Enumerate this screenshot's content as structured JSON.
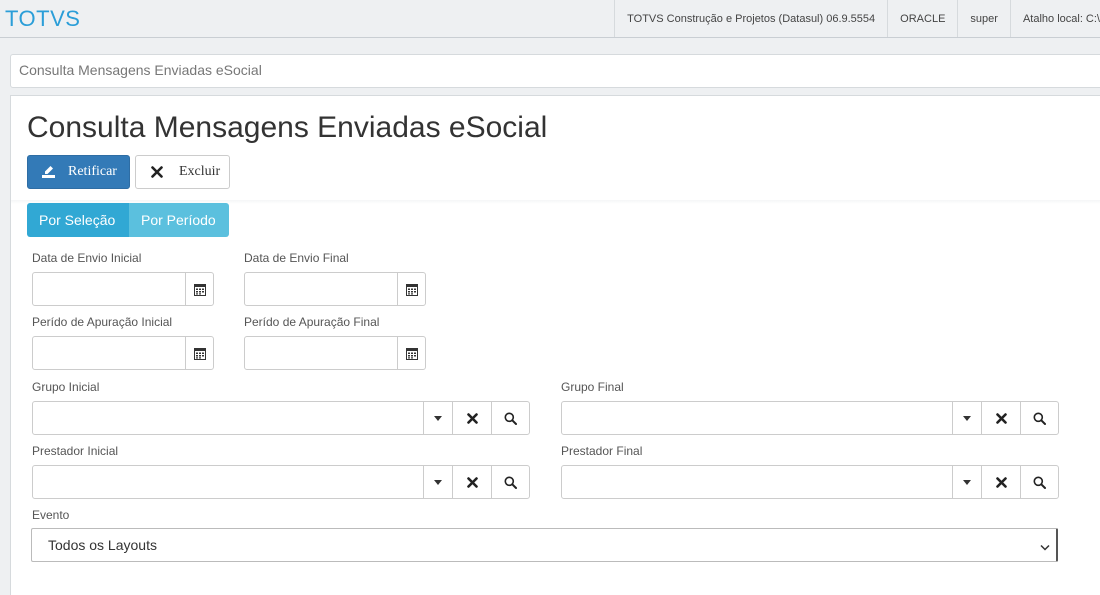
{
  "header": {
    "brand": "TOTVS",
    "product": "TOTVS Construção e Projetos (Datasul) 06.9.5554",
    "database": "ORACLE",
    "user": "super",
    "shortcut": "Atalho local: C:\\"
  },
  "breadcrumb": "Consulta Mensagens Enviadas eSocial",
  "page": {
    "title": "Consulta Mensagens Enviadas eSocial",
    "actions": {
      "retificar": "Retificar",
      "excluir": "Excluir"
    },
    "tabs": [
      {
        "label": "Por Seleção",
        "active": true
      },
      {
        "label": "Por Período",
        "active": false
      }
    ]
  },
  "form": {
    "data_envio_inicial": {
      "label": "Data de Envio Inicial",
      "value": ""
    },
    "data_envio_final": {
      "label": "Data de Envio Final",
      "value": ""
    },
    "periodo_apuracao_inicial": {
      "label": "Perído de Apuração Inicial",
      "value": ""
    },
    "periodo_apuracao_final": {
      "label": "Perído de Apuração Final",
      "value": ""
    },
    "grupo_inicial": {
      "label": "Grupo Inicial",
      "value": ""
    },
    "grupo_final": {
      "label": "Grupo Final",
      "value": ""
    },
    "prestador_inicial": {
      "label": "Prestador Inicial",
      "value": ""
    },
    "prestador_final": {
      "label": "Prestador Final",
      "value": ""
    },
    "evento": {
      "label": "Evento",
      "selected": "Todos os Layouts"
    }
  },
  "colors": {
    "brand": "#2b9ed8",
    "primary": "#337ab7",
    "tab_active": "#31a8d4",
    "tab_inactive": "#5bc0de"
  },
  "icons": {
    "retificar": "edit-icon",
    "excluir": "close-icon",
    "date": "calendar-icon",
    "dropdown": "caret-down-icon",
    "clear": "clear-icon",
    "search": "search-icon"
  }
}
